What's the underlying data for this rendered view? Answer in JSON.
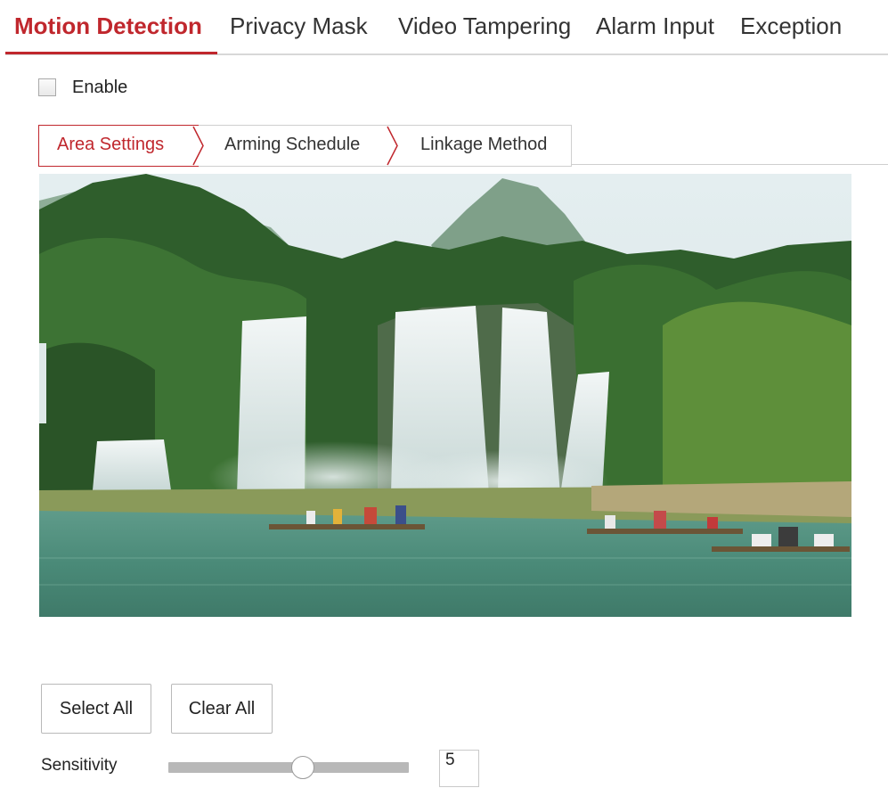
{
  "top_tabs": [
    {
      "label": "Motion Detection",
      "active": true
    },
    {
      "label": "Privacy Mask",
      "active": false
    },
    {
      "label": "Video Tampering",
      "active": false
    },
    {
      "label": "Alarm Input",
      "active": false
    },
    {
      "label": "Exception",
      "active": false
    }
  ],
  "enable": {
    "label": "Enable",
    "checked": false
  },
  "sub_tabs": [
    {
      "label": "Area Settings",
      "active": true
    },
    {
      "label": "Arming Schedule",
      "active": false
    },
    {
      "label": "Linkage Method",
      "active": false
    }
  ],
  "buttons": {
    "select_all": "Select All",
    "clear_all": "Clear All"
  },
  "sensitivity": {
    "label": "Sensitivity",
    "value": "5",
    "level_fraction": 0.56
  },
  "colors": {
    "accent": "#c0272d",
    "border": "#cfcfcf",
    "slider_track": "#b8b8b8"
  }
}
